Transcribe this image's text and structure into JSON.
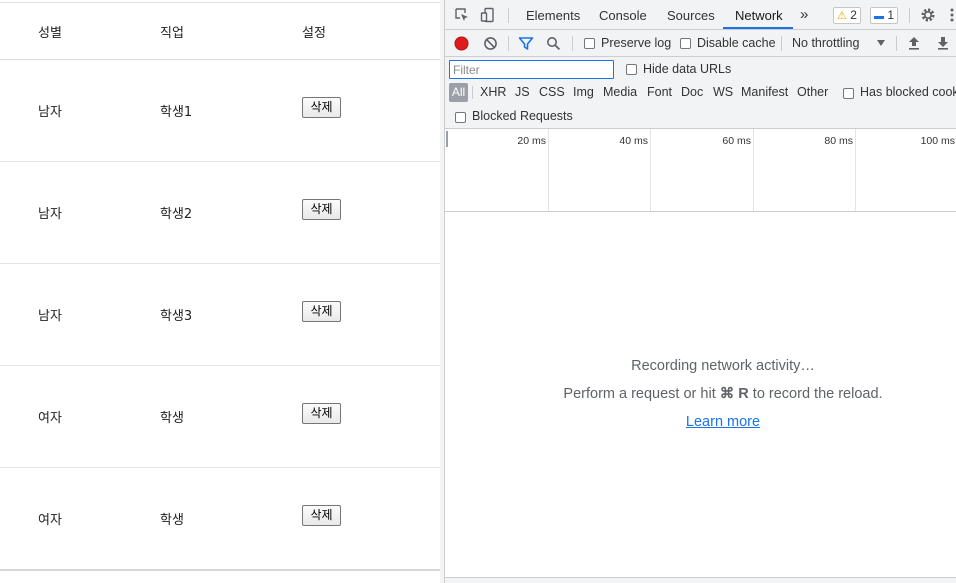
{
  "table": {
    "headers": {
      "gender": "성별",
      "job": "직업",
      "settings": "설정"
    },
    "rows": [
      {
        "gender": "남자",
        "job": "학생1",
        "action": "삭제"
      },
      {
        "gender": "남자",
        "job": "학생2",
        "action": "삭제"
      },
      {
        "gender": "남자",
        "job": "학생3",
        "action": "삭제"
      },
      {
        "gender": "여자",
        "job": "학생",
        "action": "삭제"
      },
      {
        "gender": "여자",
        "job": "학생",
        "action": "삭제"
      }
    ]
  },
  "devtools": {
    "tabs": [
      "Elements",
      "Console",
      "Sources",
      "Network"
    ],
    "active_tab": "Network",
    "more_tabs_icon": "»",
    "warnings_count": "2",
    "messages_count": "1",
    "toolbar": {
      "preserve_log": "Preserve log",
      "disable_cache": "Disable cache",
      "throttling": "No throttling"
    },
    "filter": {
      "placeholder": "Filter",
      "hide_data_urls": "Hide data URLs",
      "types": [
        "All",
        "XHR",
        "JS",
        "CSS",
        "Img",
        "Media",
        "Font",
        "Doc",
        "WS",
        "Manifest",
        "Other"
      ],
      "has_blocked_cookies": "Has blocked cookies",
      "blocked_requests": "Blocked Requests"
    },
    "timeline": {
      "ticks": [
        "20 ms",
        "40 ms",
        "60 ms",
        "80 ms",
        "100 ms"
      ]
    },
    "empty_state": {
      "line1": "Recording network activity…",
      "line2_prefix": "Perform a request or hit",
      "shortcut": "⌘ R",
      "line2_suffix": "to record the reload.",
      "learn_more": "Learn more"
    },
    "colors": {
      "record": "#e01b1b",
      "accent": "#1a73e8",
      "warning": "#e8a600"
    }
  }
}
